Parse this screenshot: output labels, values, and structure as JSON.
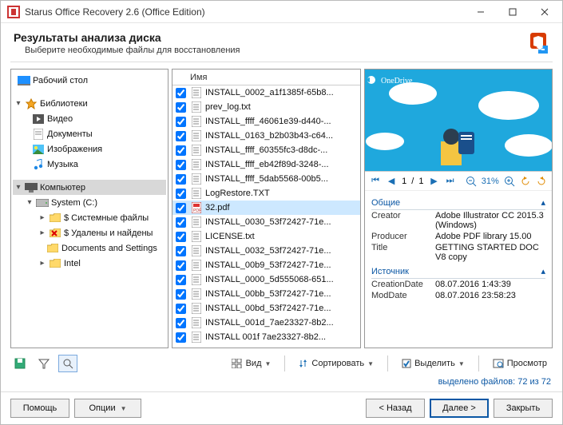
{
  "window": {
    "title": "Starus Office Recovery 2.6 (Office Edition)"
  },
  "header": {
    "title": "Результаты анализа диска",
    "subtitle": "Выберите необходимые файлы для восстановления"
  },
  "tree": {
    "desktop": "Рабочий стол",
    "libraries": "Библиотеки",
    "video": "Видео",
    "documents": "Документы",
    "images": "Изображения",
    "music": "Музыка",
    "computer": "Компьютер",
    "systemc": "System (C:)",
    "sysfiles": "$ Системные файлы",
    "deleted": "$ Удалены и найдены",
    "docs_settings": "Documents and Settings",
    "intel": "Intel"
  },
  "filelist": {
    "col_name": "Имя",
    "items": [
      {
        "name": "INSTALL_0002_a1f1385f-65b8...",
        "sel": false,
        "icon": "txt"
      },
      {
        "name": "prev_log.txt",
        "sel": false,
        "icon": "txt"
      },
      {
        "name": "INSTALL_ffff_46061e39-d440-...",
        "sel": false,
        "icon": "txt"
      },
      {
        "name": "INSTALL_0163_b2b03b43-c64...",
        "sel": false,
        "icon": "txt"
      },
      {
        "name": "INSTALL_ffff_60355fc3-d8dc-...",
        "sel": false,
        "icon": "txt"
      },
      {
        "name": "INSTALL_ffff_eb42f89d-3248-...",
        "sel": false,
        "icon": "txt"
      },
      {
        "name": "INSTALL_ffff_5dab5568-00b5...",
        "sel": false,
        "icon": "txt"
      },
      {
        "name": "LogRestore.TXT",
        "sel": false,
        "icon": "txt"
      },
      {
        "name": "32.pdf",
        "sel": true,
        "icon": "pdf"
      },
      {
        "name": "INSTALL_0030_53f72427-71e...",
        "sel": false,
        "icon": "txt"
      },
      {
        "name": "LICENSE.txt",
        "sel": false,
        "icon": "txt"
      },
      {
        "name": "INSTALL_0032_53f72427-71e...",
        "sel": false,
        "icon": "txt"
      },
      {
        "name": "INSTALL_00b9_53f72427-71e...",
        "sel": false,
        "icon": "txt"
      },
      {
        "name": "INSTALL_0000_5d555068-651...",
        "sel": false,
        "icon": "txt"
      },
      {
        "name": "INSTALL_00bb_53f72427-71e...",
        "sel": false,
        "icon": "txt"
      },
      {
        "name": "INSTALL_00bd_53f72427-71e...",
        "sel": false,
        "icon": "txt"
      },
      {
        "name": "INSTALL_001d_7ae23327-8b2...",
        "sel": false,
        "icon": "txt"
      },
      {
        "name": "INSTALL  001f  7ae23327-8b2...",
        "sel": false,
        "icon": "txt"
      }
    ]
  },
  "preview": {
    "page_current": "1",
    "page_sep": "/",
    "page_total": "1",
    "zoom": "31%",
    "onedrive_label": "OneDrive",
    "groups": {
      "general": "Общие",
      "source": "Источник"
    },
    "props_general": [
      {
        "k": "Creator",
        "v": "Adobe Illustrator CC 2015.3 (Windows)"
      },
      {
        "k": "Producer",
        "v": "Adobe PDF library 15.00"
      },
      {
        "k": "Title",
        "v": "GETTING STARTED DOC V8 copy"
      }
    ],
    "props_source": [
      {
        "k": "CreationDate",
        "v": "08.07.2016 1:43:39"
      },
      {
        "k": "ModDate",
        "v": "08.07.2016 23:58:23"
      }
    ]
  },
  "toolbar": {
    "view": "Вид",
    "sort": "Сортировать",
    "select": "Выделить",
    "preview": "Просмотр"
  },
  "status": {
    "label": "выделено файлов:",
    "value": "72 из 72"
  },
  "bottom": {
    "help": "Помощь",
    "options": "Опции",
    "back": "< Назад",
    "next": "Далее >",
    "close": "Закрыть"
  }
}
